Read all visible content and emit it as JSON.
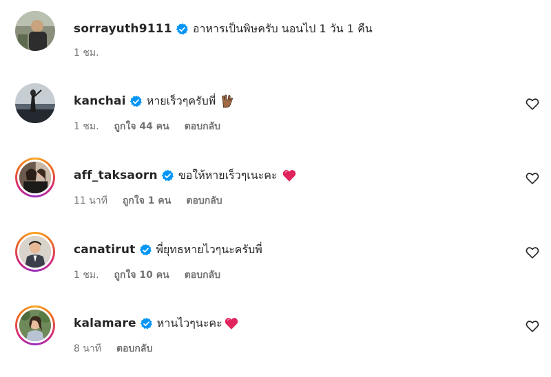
{
  "comments": [
    {
      "username": "sorrayuth9111",
      "text": "อาหารเป็นพิษครับ นอนไป 1 วัน 1 คืน",
      "time": "1 ชม.",
      "likes": "",
      "reply": ""
    },
    {
      "username": "kanchai",
      "text": "หายเร็วๆครับพี่",
      "emoji": "vulcan-salute-emoji",
      "time": "1 ชม.",
      "likes": "ถูกใจ 44 คน",
      "reply": "ตอบกลับ"
    },
    {
      "username": "aff_taksaorn",
      "text": "ขอให้หายเร็วๆเนะคะ",
      "emoji": "red-heart-emoji",
      "time": "11 นาที",
      "likes": "ถูกใจ 1 คน",
      "reply": "ตอบกลับ"
    },
    {
      "username": "canatirut",
      "text": "พี่ยุทธหายไวๆนะครับพี่",
      "time": "1 ชม.",
      "likes": "ถูกใจ 10 คน",
      "reply": "ตอบกลับ"
    },
    {
      "username": "kalamare",
      "text": "หานไวๆนะคะ",
      "emoji": "red-heart-emoji",
      "time": "8 นาที",
      "likes": "",
      "reply": "ตอบกลับ"
    }
  ],
  "colors": {
    "verified_blue": "#0095f6",
    "meta_gray": "#737373",
    "text": "#262626",
    "heart_red": "#e0245e"
  }
}
